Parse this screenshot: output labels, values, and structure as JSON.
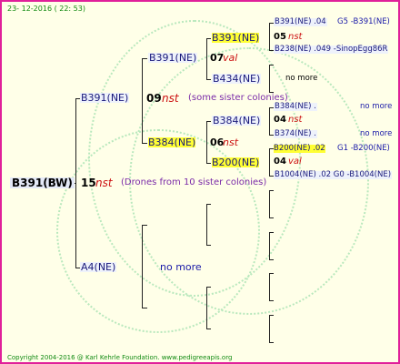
{
  "header": {
    "date": "23- 12-2016 ( 22: 53)"
  },
  "footer": {
    "copyright": "Copyright 2004-2016 @ Karl Kehrle Foundation.  www.pedigreeapis.org"
  },
  "root": {
    "name": "B391(BW)",
    "num": "15",
    "type": "nst",
    "note": "(Drones from 10 sister colonies)"
  },
  "gen1": {
    "top": {
      "name": "B391(NE)",
      "num": "09",
      "type": "nst",
      "note": "(some sister colonies)"
    },
    "bottom": {
      "name": "A4(NE)",
      "note": "no more"
    }
  },
  "gen2": {
    "a": {
      "name": "B391(NE)",
      "num": "07",
      "type": "val"
    },
    "b": {
      "name": "B384(NE)",
      "num": "06",
      "type": "nst"
    }
  },
  "gen3": {
    "a1": {
      "name": "B391(NE)",
      "num": "05",
      "type": "nst"
    },
    "a2": {
      "name": "B434(NE)",
      "note": "no more"
    },
    "b1": {
      "name": "B384(NE)",
      "num": "04",
      "type": "nst"
    },
    "b2": {
      "name": "B200(NE)",
      "num": "04",
      "type": "val"
    }
  },
  "gen4": {
    "r1": {
      "left": "B391(NE) .04",
      "right": "G5 -B391(NE)"
    },
    "r2": {
      "left": "B238(NE) .049 -SinopEgg86R"
    },
    "r3": {
      "left": "B384(NE) .",
      "right": "no more"
    },
    "r4": {
      "left": "B374(NE) .",
      "right": "no more"
    },
    "r5": {
      "left": "B200(NE) .02",
      "right": "G1 -B200(NE)"
    },
    "r6": {
      "left": "B1004(NE) .02 G0 -B1004(NE)"
    }
  }
}
